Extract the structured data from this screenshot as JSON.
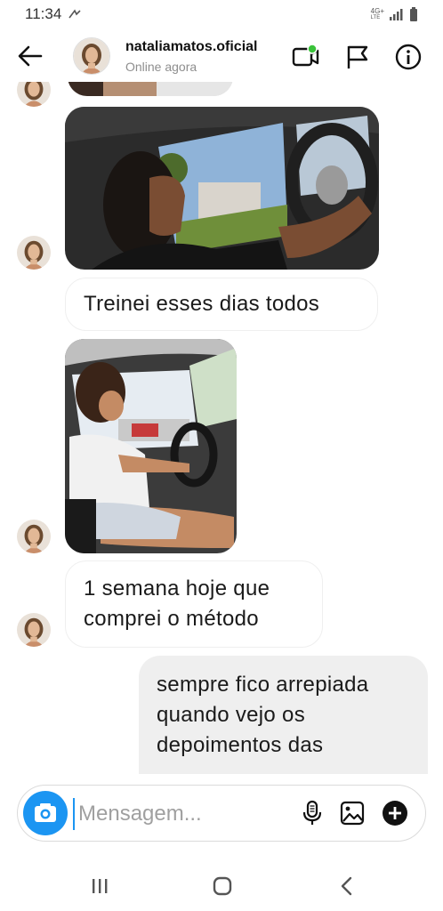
{
  "status_bar": {
    "time": "11:34",
    "network_label_top": "4G+",
    "network_label_bottom": "LTE"
  },
  "header": {
    "username": "nataliamatos.oficial",
    "status": "Online agora",
    "video_badge_color": "#3ac23a"
  },
  "messages": [
    {
      "type": "photo",
      "from": "other",
      "description_icon": "car-driving-photo"
    },
    {
      "type": "text",
      "from": "other",
      "text": "Treinei esses dias todos"
    },
    {
      "type": "photo",
      "from": "other",
      "description_icon": "car-driving-photo"
    },
    {
      "type": "text",
      "from": "other",
      "lines": [
        "1 semana hoje que",
        "comprei o método"
      ]
    },
    {
      "type": "text",
      "from": "me",
      "lines": [
        "sempre fico arrepiada",
        "quando vejo os",
        "depoimentos das"
      ]
    }
  ],
  "composer": {
    "placeholder": "Mensagem...",
    "accent_color": "#1b95f2"
  },
  "colors": {
    "accent": "#1b95f2",
    "my_bubble": "#efefef",
    "secondary_text": "#8e8e8e"
  }
}
